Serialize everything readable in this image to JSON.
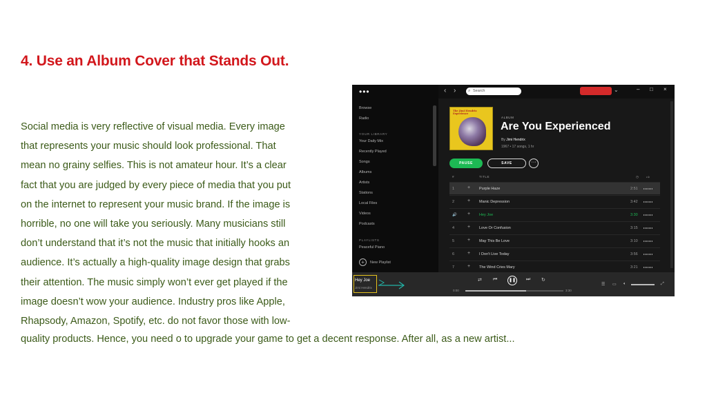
{
  "heading": "4. Use an Album Cover that Stands Out.",
  "paragraph_lines": [
    "Social media is very reflective of visual media. Every image",
    "that represents your music should look professional. That",
    "mean no grainy selfies. This is not amateur hour.  It’s a clear",
    "fact that you are judged by every piece of media that you put",
    "on the internet to represent your music brand. If the image is",
    "horrible, no one will take you seriously.  Many musicians still",
    "don’t understand that it’s not the music that initially hooks an",
    "audience. It’s actually a high-quality image design that grabs",
    "their attention. The music simply won’t ever get played if the",
    "image doesn’t wow your audience.  Industry pros like Apple,",
    "Rhapsody, Amazon, Spotify, etc. do not favor those with low-"
  ],
  "paragraph_last_line": "quality products. Hence, you need o to upgrade your game to get a decent response. After all, as a new artist...",
  "screenshot": {
    "sidebar": {
      "menu_dots": "•••",
      "items": [
        "Browse",
        "Radio"
      ],
      "library_heading": "YOUR LIBRARY",
      "library_items": [
        "Your Daily Mix",
        "Recently Played",
        "Songs",
        "Albums",
        "Artists",
        "Stations",
        "Local Files",
        "Videos",
        "Podcasts"
      ],
      "playlists_heading": "PLAYLISTS",
      "playlist_items": [
        "Peaceful Piano"
      ],
      "new_playlist": "New Playlist"
    },
    "topbar": {
      "search_placeholder": "Search",
      "minimize": "–",
      "maximize": "□",
      "close": "×"
    },
    "album": {
      "cover_text": "The Jimi Hendrix Experience",
      "label": "ALBUM",
      "title": "Are You Experienced",
      "by": "By",
      "artist": "Jimi Hendrix",
      "meta": "1967 • 17 songs, 1 hr",
      "pause_label": "PAUSE",
      "save_label": "SAVE",
      "more_label": "···"
    },
    "table": {
      "col_num": "#",
      "col_title": "TITLE",
      "tracks": [
        {
          "num": "1",
          "title": "Purple Haze",
          "duration": "2:51"
        },
        {
          "num": "2",
          "title": "Manic Depression",
          "duration": "3:42"
        },
        {
          "num": "🔊",
          "title": "Hey Joe",
          "duration": "3:30"
        },
        {
          "num": "4",
          "title": "Love Or Confusion",
          "duration": "3:15"
        },
        {
          "num": "5",
          "title": "May This Be Love",
          "duration": "3:10"
        },
        {
          "num": "6",
          "title": "I Don't Live Today",
          "duration": "3:56"
        },
        {
          "num": "7",
          "title": "The Wind Cries Mary",
          "duration": "3:21"
        }
      ],
      "selected_row": 0,
      "playing_row": 2
    },
    "player": {
      "now_playing_title": "Hey Joe",
      "now_playing_artist": "Jimi Hendrix",
      "time_elapsed": "0:00",
      "time_total": "3:30",
      "progress_fraction": 0.62
    },
    "colors": {
      "accent_green": "#1db954",
      "heading_red": "#d2171c",
      "body_text": "#3b5a18",
      "annotation_teal": "#22b3a6",
      "annotation_yellow": "#e6c21e"
    }
  }
}
